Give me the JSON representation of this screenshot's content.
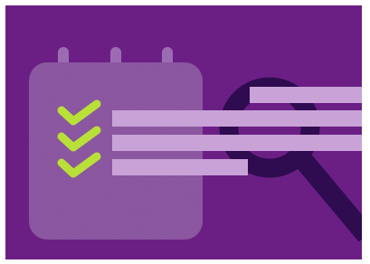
{
  "illustration": {
    "subject": "calendar-checklist-with-magnifying-glass",
    "colors": {
      "background": "#6b1f85",
      "calendar_body": "#8a559f",
      "calendar_rings": "#9c6cb2",
      "checkmarks": "#b9e038",
      "bars": "#c9a2d8",
      "magnifier": "#2f0b4f"
    },
    "checklist": {
      "checked_items": 3
    },
    "icons": [
      "calendar-icon",
      "checkmark-icon",
      "magnifying-glass-icon"
    ]
  }
}
